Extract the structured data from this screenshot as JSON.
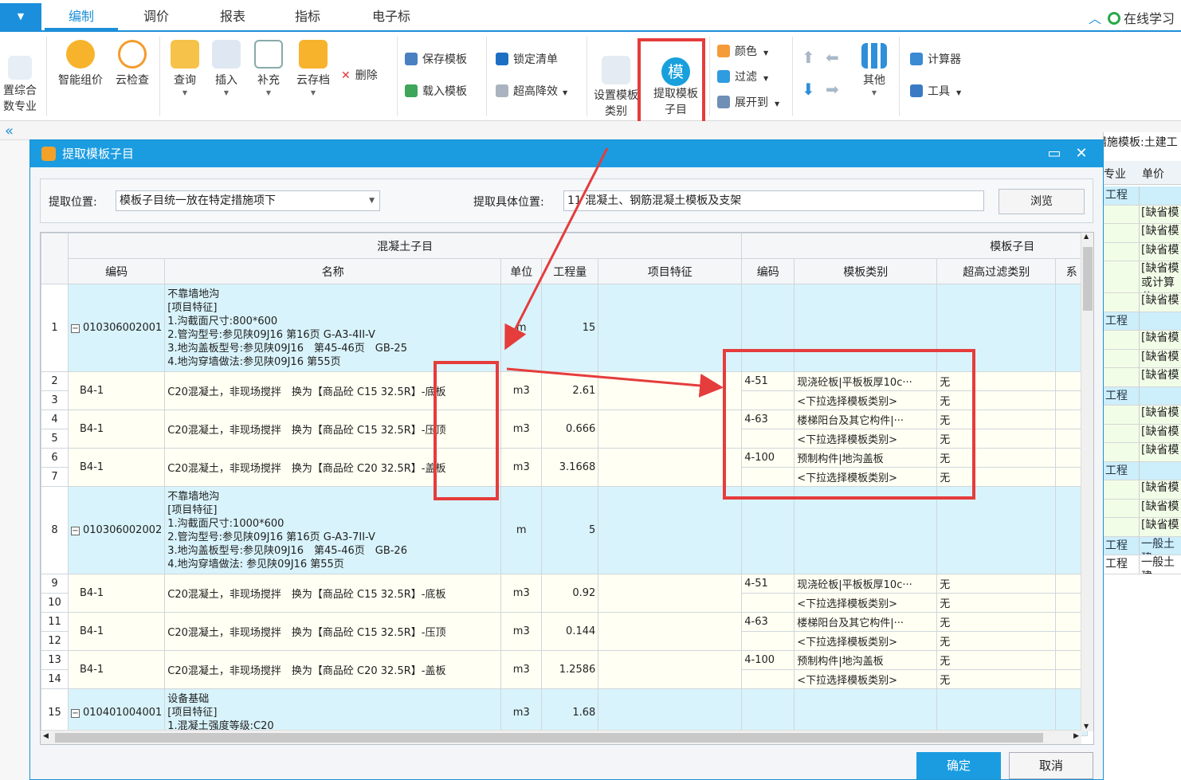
{
  "menu": {
    "dropdown_icon": "caret-down-icon",
    "tabs": [
      "编制",
      "调价",
      "报表",
      "指标",
      "电子标"
    ],
    "right": "在线学习"
  },
  "ribbon": {
    "big": {
      "set_combined": "置综合\n数专业",
      "smart_price": "智能组价",
      "cloud_check": "云检查",
      "query": "查询",
      "insert": "插入",
      "supplement": "补充",
      "cloud_archive": "云存档",
      "set_template_type": "设置模板\n类别",
      "extract_template": "提取模板\n子目",
      "other": "其他",
      "extract_icon_char": "模"
    },
    "small": {
      "delete": "删除",
      "save_template": "保存模板",
      "load_template": "载入模板",
      "lock_list": "锁定清单",
      "over_height": "超高降效",
      "color": "颜色",
      "filter": "过滤",
      "expand_to": "展开到",
      "calculator": "计算器",
      "tools": "工具"
    }
  },
  "background": {
    "right_panel_title": "措施模板:土建工",
    "right_panel_headers": [
      "专业",
      "单价"
    ],
    "right_rows": [
      {
        "c1": "工程",
        "c2": "",
        "type": "cat"
      },
      {
        "c1": "",
        "c2": "[缺省模",
        "type": "cmt"
      },
      {
        "c1": "",
        "c2": "[缺省模",
        "type": "cmt"
      },
      {
        "c1": "",
        "c2": "[缺省模",
        "type": "cmt"
      },
      {
        "c1": "",
        "c2": "[缺省模 或计算公",
        "type": "cmt"
      },
      {
        "c1": "",
        "c2": "[缺省模",
        "type": "cmt"
      },
      {
        "c1": "工程",
        "c2": "",
        "type": "cat"
      },
      {
        "c1": "",
        "c2": "[缺省模",
        "type": "cmt"
      },
      {
        "c1": "",
        "c2": "[缺省模",
        "type": "cmt"
      },
      {
        "c1": "",
        "c2": "[缺省模",
        "type": "cmt"
      },
      {
        "c1": "工程",
        "c2": "",
        "type": "cat"
      },
      {
        "c1": "",
        "c2": "[缺省模",
        "type": "cmt"
      },
      {
        "c1": "",
        "c2": "[缺省模",
        "type": "cmt"
      },
      {
        "c1": "",
        "c2": "[缺省模",
        "type": "cmt"
      },
      {
        "c1": "工程",
        "c2": "",
        "type": "cat"
      },
      {
        "c1": "",
        "c2": "[缺省模",
        "type": "cmt"
      },
      {
        "c1": "",
        "c2": "[缺省模",
        "type": "cmt"
      },
      {
        "c1": "",
        "c2": "[缺省模",
        "type": "cmt"
      },
      {
        "c1": "工程",
        "c2": "一般土建",
        "type": "cat"
      },
      {
        "c1": "工程",
        "c2": "一般土建",
        "type": "plain"
      }
    ]
  },
  "dialog": {
    "title": "提取模板子目",
    "extract_location_label": "提取位置:",
    "extract_location_value": "模板子目统一放在特定措施项下",
    "specific_location_label": "提取具体位置:",
    "specific_location_value": "11 混凝土、钢筋混凝土模板及支架",
    "browse": "浏览",
    "ok": "确定",
    "cancel": "取消",
    "group_headers": {
      "concrete": "混凝土子目",
      "template": "模板子目"
    },
    "columns": [
      "编码",
      "名称",
      "单位",
      "工程量",
      "项目特征",
      "编码",
      "模板类别",
      "超高过滤类别",
      "系"
    ],
    "rows": [
      {
        "n": "1",
        "kind": "parent",
        "code": "010306002001",
        "name": [
          "不靠墙地沟",
          "[项目特征]",
          "1.沟截面尺寸:800*600",
          "2.管沟型号:参见陕09J16 第16页 G-A3-4II-V",
          "3.地沟盖板型号:参见陕09J16　第45-46页　GB-25",
          "4.地沟穿墙做法:参见陕09J16 第55页"
        ],
        "unit": "m",
        "qty": "15"
      },
      {
        "n": [
          "2",
          "3"
        ],
        "kind": "child",
        "code": "B4-1",
        "name": "C20混凝土，非现场搅拌　换为【商品砼 C15 32.5R】-底板",
        "unit": "m3",
        "qty": "2.61",
        "tpl": [
          {
            "code": "4-51",
            "type": "现浇砼板|平板板厚10c···",
            "filter": "无"
          },
          {
            "code": "",
            "type": "<下拉选择模板类别>",
            "filter": "无"
          }
        ]
      },
      {
        "n": [
          "4",
          "5"
        ],
        "kind": "child",
        "code": "B4-1",
        "name": "C20混凝土，非现场搅拌　换为【商品砼 C15 32.5R】-压顶",
        "unit": "m3",
        "qty": "0.666",
        "tpl": [
          {
            "code": "4-63",
            "type": "楼梯阳台及其它构件|···",
            "filter": "无"
          },
          {
            "code": "",
            "type": "<下拉选择模板类别>",
            "filter": "无"
          }
        ]
      },
      {
        "n": [
          "6",
          "7"
        ],
        "kind": "child",
        "code": "B4-1",
        "name": "C20混凝土，非现场搅拌　换为【商品砼 C20 32.5R】-盖板",
        "unit": "m3",
        "qty": "3.1668",
        "tpl": [
          {
            "code": "4-100",
            "type": "预制构件|地沟盖板",
            "filter": "无"
          },
          {
            "code": "",
            "type": "<下拉选择模板类别>",
            "filter": "无"
          }
        ]
      },
      {
        "n": "8",
        "kind": "parent",
        "code": "010306002002",
        "name": [
          "不靠墙地沟",
          "[项目特征]",
          "1.沟截面尺寸:1000*600",
          "2.管沟型号:参见陕09J16 第16页 G-A3-7II-V",
          "3.地沟盖板型号:参见陕09J16　第45-46页　GB-26",
          "4.地沟穿墙做法: 参见陕09J16 第55页"
        ],
        "unit": "m",
        "qty": "5"
      },
      {
        "n": [
          "9",
          "10"
        ],
        "kind": "child",
        "code": "B4-1",
        "name": "C20混凝土，非现场搅拌　换为【商品砼 C15 32.5R】-底板",
        "unit": "m3",
        "qty": "0.92",
        "tpl": [
          {
            "code": "4-51",
            "type": "现浇砼板|平板板厚10c···",
            "filter": "无"
          },
          {
            "code": "",
            "type": "<下拉选择模板类别>",
            "filter": "无"
          }
        ]
      },
      {
        "n": [
          "11",
          "12"
        ],
        "kind": "child",
        "code": "B4-1",
        "name": "C20混凝土，非现场搅拌　换为【商品砼 C15 32.5R】-压顶",
        "unit": "m3",
        "qty": "0.144",
        "tpl": [
          {
            "code": "4-63",
            "type": "楼梯阳台及其它构件|···",
            "filter": "无"
          },
          {
            "code": "",
            "type": "<下拉选择模板类别>",
            "filter": "无"
          }
        ]
      },
      {
        "n": [
          "13",
          "14"
        ],
        "kind": "child",
        "code": "B4-1",
        "name": "C20混凝土，非现场搅拌　换为【商品砼 C20 32.5R】-盖板",
        "unit": "m3",
        "qty": "1.2586",
        "tpl": [
          {
            "code": "4-100",
            "type": "预制构件|地沟盖板",
            "filter": "无"
          },
          {
            "code": "",
            "type": "<下拉选择模板类别>",
            "filter": "无"
          }
        ]
      },
      {
        "n": "15",
        "kind": "parent",
        "code": "010401004001",
        "name": [
          "设备基础",
          "[项目特征]",
          "1.混凝土强度等级:C20"
        ],
        "unit": "m3",
        "qty": "1.68"
      }
    ]
  }
}
